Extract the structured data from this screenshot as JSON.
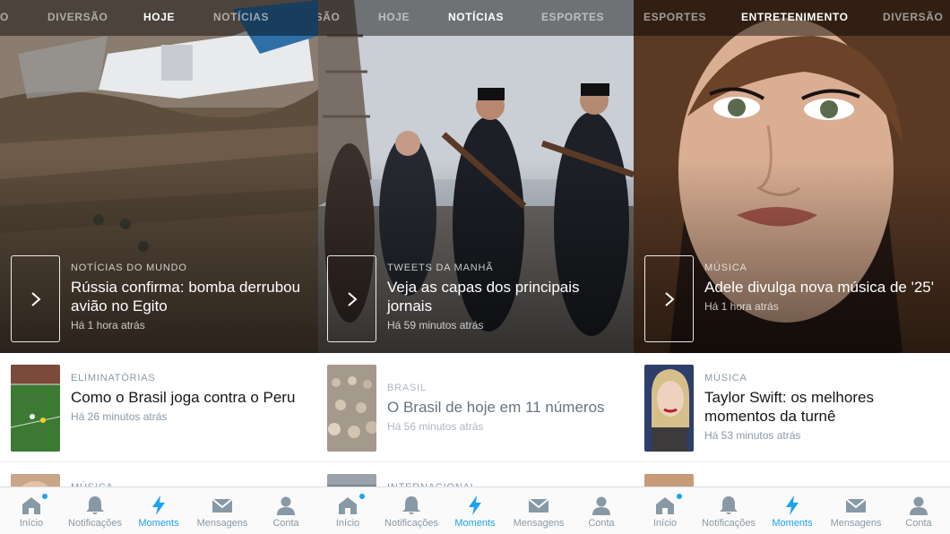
{
  "colors": {
    "accent": "#1da1f2",
    "text": "#14171a",
    "muted": "#8899a6"
  },
  "tab_icons": [
    "home-icon",
    "bell-icon",
    "lightning-icon",
    "envelope-icon",
    "person-icon"
  ],
  "panels": [
    {
      "nav": [
        "O",
        "DIVERSÃO",
        "HOJE",
        "NOTÍCIAS"
      ],
      "active_nav": "HOJE",
      "hero": {
        "category": "NOTÍCIAS DO MUNDO",
        "title": "Rússia confirma: bomba derrubou avião no Egito",
        "time": "Há 1 hora atrás"
      },
      "row": {
        "category": "ELIMINATÓRIAS",
        "title": "Como o Brasil joga contra o Peru",
        "time": "Há 26 minutos atrás"
      },
      "peek_category": "MÚSICA",
      "tabs": [
        "Início",
        "Notificações",
        "Moments",
        "Mensagens",
        "Conta"
      ],
      "active_tab": "Moments"
    },
    {
      "nav": [
        "ESÃO",
        "HOJE",
        "NOTÍCIAS",
        "ESPORTES"
      ],
      "active_nav": "NOTÍCIAS",
      "hero": {
        "category": "TWEETS DA MANHÃ",
        "title": "Veja as capas dos principais jornais",
        "time": "Há 59 minutos atrás"
      },
      "row": {
        "category": "BRASIL",
        "title": "O Brasil de hoje em 11 números",
        "time": "Há 56 minutos atrás"
      },
      "peek_category": "INTERNACIONAL",
      "tabs": [
        "Início",
        "Notificações",
        "Moments",
        "Mensagens",
        "Conta"
      ],
      "active_tab": "Moments"
    },
    {
      "nav": [
        "ESPORTES",
        "ENTRETENIMENTO",
        "DIVERSÃO"
      ],
      "active_nav": "ENTRETENIMENTO",
      "hero": {
        "category": "MÚSICA",
        "title": "Adele divulga nova música de '25'",
        "time": "Há 1 hora atrás"
      },
      "row": {
        "category": "MÚSICA",
        "title": "Taylor Swift: os melhores momentos da turnê",
        "time": "Há 53 minutos atrás"
      },
      "peek_category": "",
      "tabs": [
        "Início",
        "Notificações",
        "Moments",
        "Mensagens",
        "Conta"
      ],
      "active_tab": "Moments"
    }
  ]
}
